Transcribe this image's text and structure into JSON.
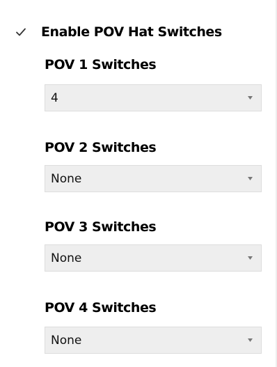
{
  "enable_pov": {
    "label": "Enable POV Hat Switches",
    "checked": true
  },
  "pov_groups": [
    {
      "label": "POV 1 Switches",
      "value": "4"
    },
    {
      "label": "POV 2 Switches",
      "value": "None"
    },
    {
      "label": "POV 3 Switches",
      "value": "None"
    },
    {
      "label": "POV 4 Switches",
      "value": "None"
    }
  ],
  "colors": {
    "dropdown_bg": "#eeeeee",
    "dropdown_border": "#dddddd",
    "arrow": "#777777",
    "check": "#333333"
  }
}
